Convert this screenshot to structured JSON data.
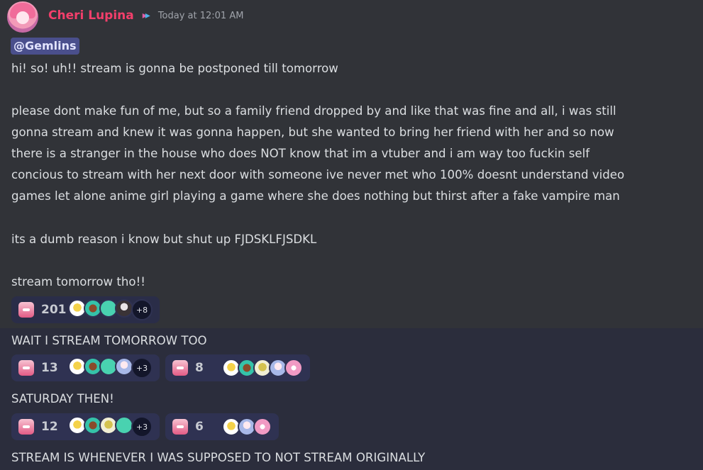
{
  "message": {
    "username": "Cheri Lupina",
    "role_icon": "double-chevron-icon",
    "timestamp": "Today at 12:01 AM",
    "mention": "@Gemlins",
    "lines": [
      "hi! so! uh!! stream is gonna be postponed till tomorrow",
      "please dont make fun of me, but so a family friend dropped by and like that was fine and all, i was still",
      "gonna stream and knew it was gonna happen, but she wanted to bring her friend with her and so now",
      "there is a stranger in the house who does NOT know that im a vtuber and i am way too fuckin self",
      "concious to stream with her next door with someone ive never met who 100% doesnt understand video",
      "games let alone anime girl playing a game where she does nothing but thirst after a fake vampire man",
      "its a dumb reason i know but shut up FJDSKLFJSDKL",
      "stream tomorrow tho!!"
    ],
    "reaction": {
      "emoji": "sad-anime-girl-emoji",
      "count": "201",
      "more": "+8"
    }
  },
  "replies": [
    {
      "text": "WAIT I STREAM TOMORROW TOO",
      "reactions": [
        {
          "emoji": "sad-anime-girl-emoji",
          "count": "13",
          "more": "+3"
        },
        {
          "emoji": "anime-girl-emoji",
          "count": "8",
          "more": ""
        }
      ]
    },
    {
      "text": "SATURDAY THEN!",
      "reactions": [
        {
          "emoji": "sad-anime-girl-emoji",
          "count": "12",
          "more": "+3"
        },
        {
          "emoji": "anime-girl-emoji",
          "count": "6",
          "more": ""
        }
      ]
    },
    {
      "text": "STREAM IS WHENEVER I WAS SUPPOSED TO NOT STREAM ORIGINALLY",
      "reactions": []
    }
  ],
  "colors": {
    "username": "#f23f6b",
    "mention_bg": "#4a4f8c",
    "message_bg": "#313338",
    "background": "#2b2d3c"
  }
}
